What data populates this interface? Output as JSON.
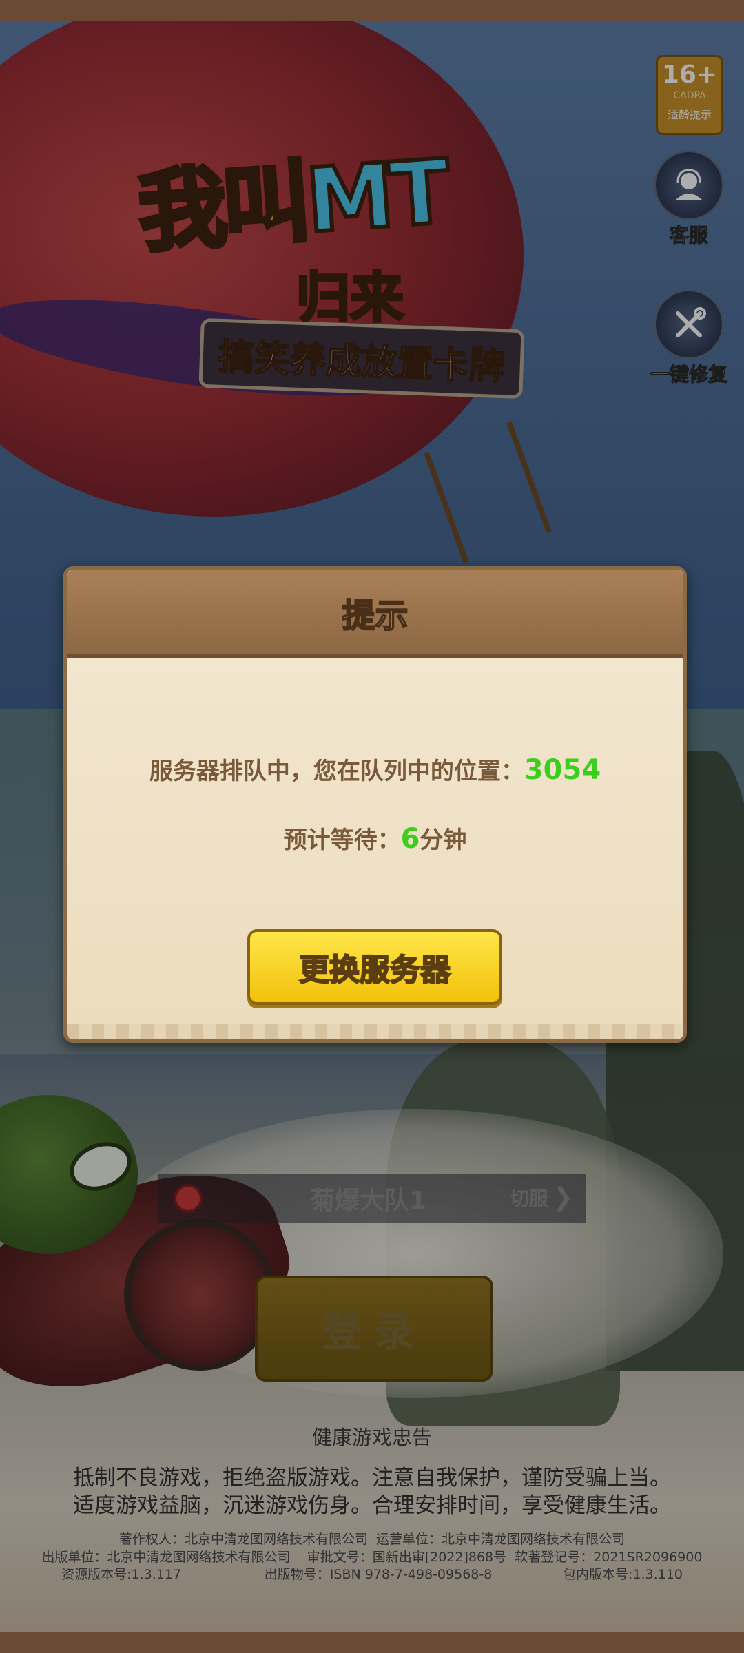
{
  "age_badge": {
    "rating": "16+",
    "org": "CADPA",
    "tip": "适龄提示"
  },
  "side_buttons": {
    "service": "客服",
    "repair": "一键修复"
  },
  "logo": {
    "main_a": "我叫",
    "main_b": "MT",
    "sub1": "归来",
    "sub2": "搞笑养成放置卡牌"
  },
  "dialog": {
    "title": "提示",
    "queue_text": "服务器排队中，您在队列中的位置：",
    "queue_position": "3054",
    "wait_label": "预计等待：",
    "wait_minutes": "6",
    "wait_unit": "分钟",
    "change_server_label": "更换服务器"
  },
  "server": {
    "name": "菊爆大队1",
    "switch_label": "切服"
  },
  "login_label": "登录",
  "health": {
    "title": "健康游戏忠告",
    "line1": "抵制不良游戏，拒绝盗版游戏。注意自我保护，谨防受骗上当。",
    "line2": "适度游戏益脑，沉迷游戏伤身。合理安排时间，享受健康生活。"
  },
  "legal": {
    "line1": "著作权人：北京中清龙图网络技术有限公司  运营单位：北京中清龙图网络技术有限公司",
    "line2": "出版单位：北京中清龙图网络技术有限公司    审批文号：国新出审[2022]868号  软著登记号：2021SR2096900",
    "line3": "资源版本号:1.3.117                    出版物号：ISBN 978-7-498-09568-8                 包内版本号:1.3.110"
  },
  "colors": {
    "queue_highlight": "#3ccd1e",
    "dialog_header": "#8e6843",
    "button_yellow": "#f2c10a"
  }
}
